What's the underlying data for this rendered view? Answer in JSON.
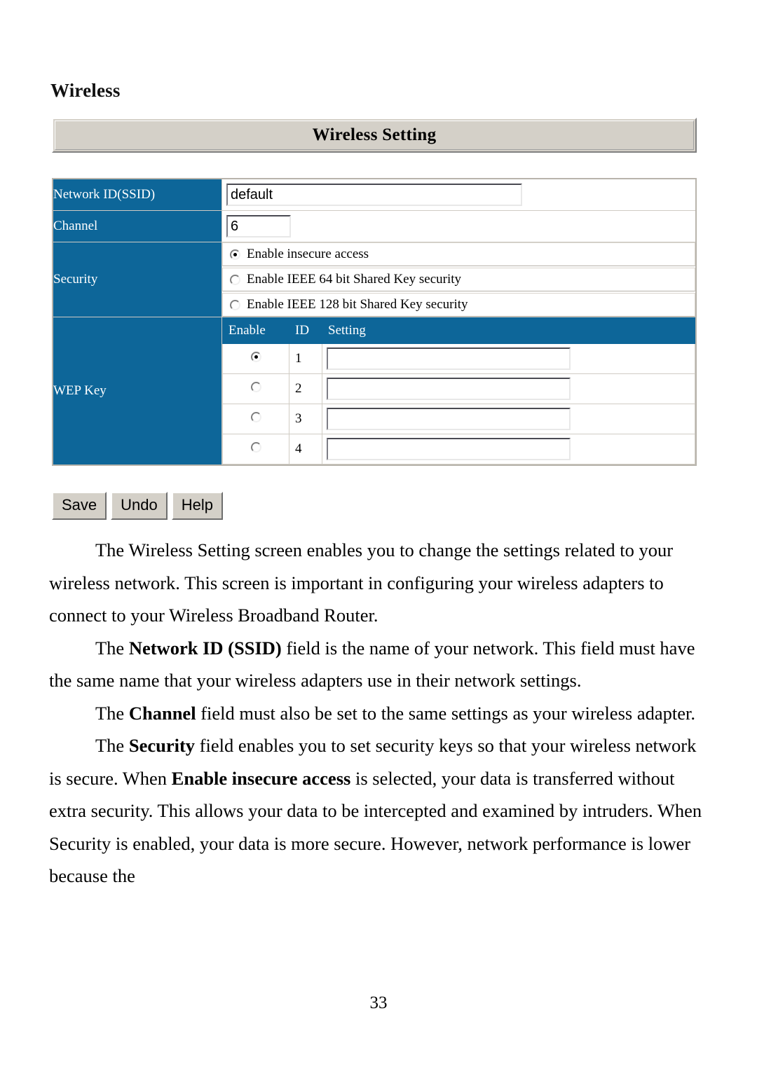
{
  "page": {
    "heading": "Wireless",
    "number": "33"
  },
  "figure": {
    "titlebar": "Wireless Setting",
    "rows": {
      "ssid": {
        "label": "Network ID(SSID)",
        "value": "default"
      },
      "channel": {
        "label": "Channel",
        "value": "6"
      },
      "security": {
        "label": "Security",
        "options": [
          {
            "label": "Enable insecure access",
            "checked": true
          },
          {
            "label": "Enable IEEE 64 bit Shared Key security",
            "checked": false
          },
          {
            "label": "Enable IEEE 128 bit Shared Key security",
            "checked": false
          }
        ]
      },
      "wep": {
        "label": "WEP Key",
        "headers": {
          "enable": "Enable",
          "id": "ID",
          "setting": "Setting"
        },
        "keys": [
          {
            "id": "1",
            "checked": true,
            "value": ""
          },
          {
            "id": "2",
            "checked": false,
            "value": ""
          },
          {
            "id": "3",
            "checked": false,
            "value": ""
          },
          {
            "id": "4",
            "checked": false,
            "value": ""
          }
        ]
      }
    },
    "buttons": {
      "save": "Save",
      "undo": "Undo",
      "help": "Help"
    }
  },
  "colors": {
    "label_blue": "#0d6699",
    "panel_gray": "#d4d0c8",
    "text_black": "#000000"
  },
  "body": {
    "paragraphs": [
      {
        "segments": [
          {
            "text": "The Wireless Setting screen enables you to change the settings related to your wireless network. This screen is important in configuring your wireless adapters to connect to your Wireless Broadband Router.",
            "bold": false
          }
        ]
      },
      {
        "segments": [
          {
            "text": "The ",
            "bold": false
          },
          {
            "text": "Network ID (SSID)",
            "bold": true
          },
          {
            "text": " field is the name of your network. This field must have the same name that your wireless adapters use in their network settings.",
            "bold": false
          }
        ]
      },
      {
        "segments": [
          {
            "text": "The ",
            "bold": false
          },
          {
            "text": "Channel",
            "bold": true
          },
          {
            "text": " field must also be set to the same settings as your wireless adapter.",
            "bold": false
          }
        ]
      },
      {
        "segments": [
          {
            "text": "The ",
            "bold": false
          },
          {
            "text": "Security",
            "bold": true
          },
          {
            "text": " field enables you to set security keys so that your wireless network is secure. When ",
            "bold": false
          },
          {
            "text": "Enable insecure access",
            "bold": true
          },
          {
            "text": " is selected, your data is transferred without extra security. This allows your data to be intercepted and examined by intruders. When Security is enabled, your data is more secure. However, network performance is lower because the",
            "bold": false
          }
        ]
      }
    ]
  }
}
